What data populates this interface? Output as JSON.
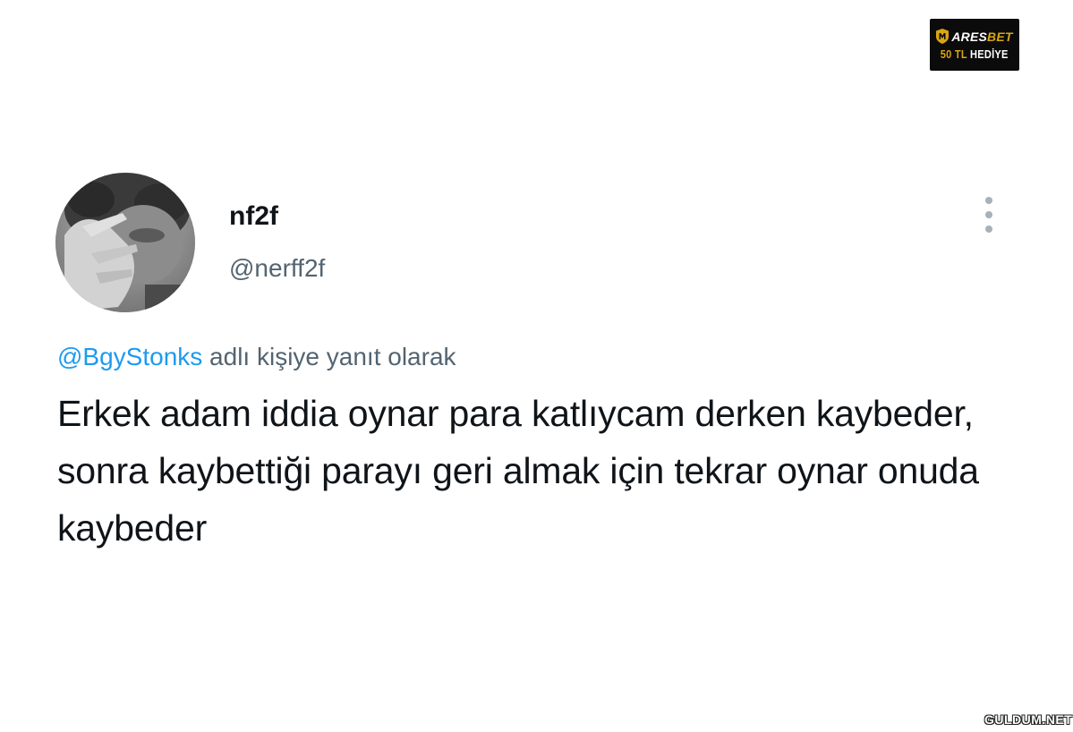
{
  "sponsor": {
    "brand_main": "ARES",
    "brand_accent": "BET",
    "gift_amount": "50 TL",
    "gift_word": "HEDİYE",
    "accent_color": "#d8a514"
  },
  "author": {
    "display_name": "nf2f",
    "handle": "@nerff2f",
    "avatar_icon": "profile-avatar"
  },
  "menu": {
    "icon": "more-vertical-icon"
  },
  "reply": {
    "mention": "@BgyStonks",
    "suffix": " adlı kişiye yanıt olarak"
  },
  "tweet": {
    "text": "Erkek adam iddia oynar para katlıycam derken kaybeder, sonra kaybettiği parayı geri almak için tekrar oynar onuda kaybeder"
  },
  "watermark": {
    "text": "GULDUM.NET"
  },
  "colors": {
    "link": "#1d9bf0",
    "secondary_text": "#536471",
    "primary_text": "#0f1419"
  }
}
